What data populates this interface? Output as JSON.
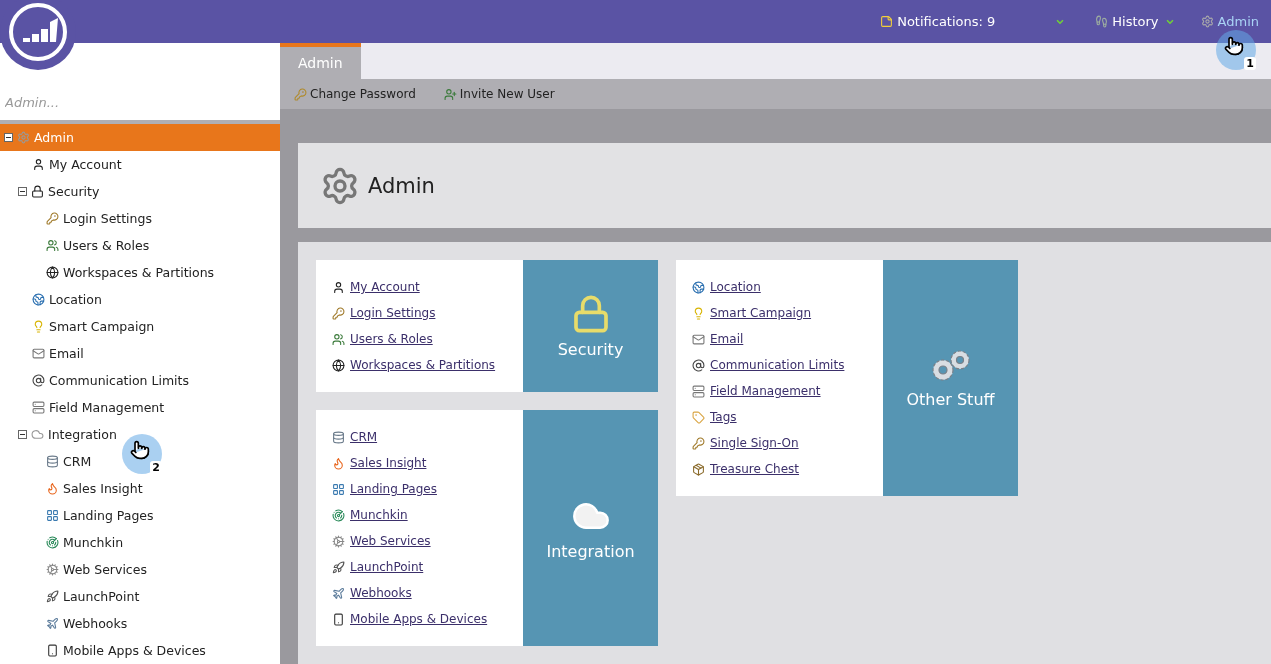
{
  "top_bar": {
    "notifications": "Notifications: 9",
    "history": "History",
    "admin": "Admin"
  },
  "search": {
    "placeholder": "Admin..."
  },
  "tabs": [
    {
      "label": "Admin",
      "selected": true
    }
  ],
  "toolbar": [
    "Change Password",
    "Invite New User"
  ],
  "tree": [
    {
      "label": "Admin",
      "selected": true,
      "expanded": true,
      "children": [
        {
          "label": "My Account",
          "selected": false
        },
        {
          "label": "Security",
          "selected": false,
          "expanded": true,
          "children": [
            {
              "label": "Login Settings",
              "selected": false
            },
            {
              "label": "Users & Roles",
              "selected": false
            },
            {
              "label": "Workspaces & Partitions",
              "selected": false
            }
          ]
        },
        {
          "label": "Location",
          "selected": false
        },
        {
          "label": "Smart Campaign",
          "selected": false
        },
        {
          "label": "Email",
          "selected": false
        },
        {
          "label": "Communication Limits",
          "selected": false
        },
        {
          "label": "Field Management",
          "selected": false
        },
        {
          "label": "Integration",
          "selected": false,
          "expanded": true,
          "children": [
            {
              "label": "CRM",
              "selected": false
            },
            {
              "label": "Sales Insight",
              "selected": false
            },
            {
              "label": "Landing Pages",
              "selected": false
            },
            {
              "label": "Munchkin",
              "selected": false
            },
            {
              "label": "Web Services",
              "selected": false
            },
            {
              "label": "LaunchPoint",
              "selected": false
            },
            {
              "label": "Webhooks",
              "selected": false
            },
            {
              "label": "Mobile Apps & Devices",
              "selected": false
            }
          ]
        }
      ]
    }
  ],
  "page_title": "Admin",
  "cards": [
    {
      "title": "Security",
      "links": [
        "My Account",
        "Login Settings",
        "Users & Roles",
        "Workspaces & Partitions"
      ]
    },
    {
      "title": "Integration",
      "links": [
        "CRM",
        "Sales Insight",
        "Landing Pages",
        "Munchkin",
        "Web Services",
        "LaunchPoint",
        "Webhooks",
        "Mobile Apps & Devices"
      ]
    },
    {
      "title": "Other Stuff",
      "links": [
        "Location",
        "Smart Campaign",
        "Email",
        "Communication Limits",
        "Field Management",
        "Tags",
        "Single Sign-On",
        "Treasure Chest"
      ]
    }
  ],
  "callouts": [
    {
      "label": "1"
    },
    {
      "label": "2"
    }
  ]
}
